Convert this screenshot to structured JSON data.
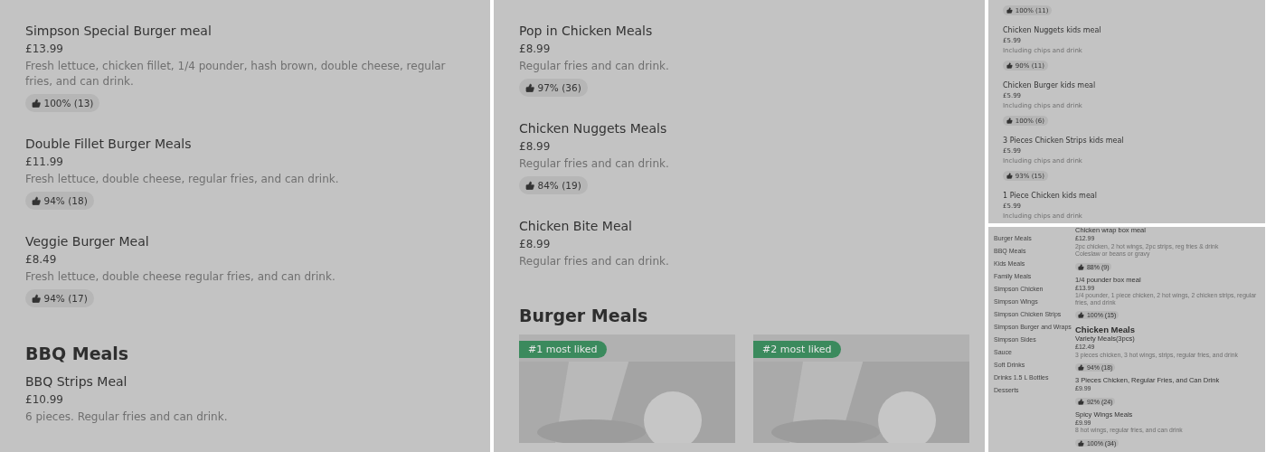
{
  "panels": [
    {
      "kind": "regular",
      "sections": [
        {
          "items": [
            {
              "name": "Simpson Special Burger meal",
              "price": "£13.99",
              "description": "Fresh lettuce, chicken fillet, 1/4 pounder, hash brown, double cheese, regular fries, and can drink.",
              "rating": "100% (13)"
            },
            {
              "name": "Double Fillet Burger Meals",
              "price": "£11.99",
              "description": "Fresh lettuce, double cheese, regular fries, and can drink.",
              "rating": "94% (18)"
            },
            {
              "name": "Veggie Burger Meal",
              "price": "£8.49",
              "description": "Fresh lettuce, double cheese regular fries, and can drink.",
              "rating": "94% (17)"
            }
          ]
        },
        {
          "heading": "BBQ Meals",
          "items": [
            {
              "name": "BBQ Strips Meal",
              "price": "£10.99",
              "description": "6 pieces. Regular fries and can drink."
            }
          ]
        }
      ]
    },
    {
      "kind": "regular",
      "sections": [
        {
          "items": [
            {
              "name": "Pop in Chicken Meals",
              "price": "£8.99",
              "description": "Regular fries and can drink.",
              "rating": "97% (36)"
            },
            {
              "name": "Chicken Nuggets Meals",
              "price": "£8.99",
              "description": "Regular fries and can drink.",
              "rating": "84% (19)"
            },
            {
              "name": "Chicken Bite Meal",
              "price": "£8.99",
              "description": "Regular fries and can drink."
            }
          ]
        },
        {
          "heading": "Burger Meals",
          "cards": [
            {
              "badge": "#1 most liked",
              "kind": "picture"
            },
            {
              "badge": "#2 most liked",
              "kind": "picture"
            }
          ]
        }
      ]
    },
    {
      "kind": "compact",
      "sections": [
        {
          "items": [
            {
              "rating": "100% (11)"
            },
            {
              "name": "Chicken Nuggets kids meal",
              "price": "£5.99",
              "description": "Including chips and drink",
              "rating": "90% (11)"
            },
            {
              "name": "Chicken Burger kids meal",
              "price": "£5.99",
              "description": "Including chips and drink",
              "rating": "100% (6)"
            },
            {
              "name": "3 Pieces Chicken Strips kids meal",
              "price": "£5.99",
              "description": "Including chips and drink",
              "rating": "93% (15)"
            },
            {
              "name": "1 Piece Chicken kids meal",
              "price": "£5.99",
              "description": "Including chips and drink"
            }
          ]
        }
      ]
    },
    {
      "kind": "tiny",
      "sidebar": [
        "Burger Meals",
        "BBQ Meals",
        "Kids Meals",
        "Family Meals",
        "Simpson Chicken",
        "Simpson Wings",
        "Simpson Chicken Strips",
        "Simpson Burger and Wraps",
        "Simpson Sides",
        "Sauce",
        "Soft Drinks",
        "Drinks 1.5 L Bottles",
        "Desserts"
      ],
      "sections": [
        {
          "items": [
            {
              "name": "Chicken wrap box meal",
              "price": "£12.99",
              "description": "2pc chicken, 2 hot wings, 2pc strips, reg fries & drink",
              "note": "Coleslaw or beans or gravy",
              "rating": "88% (9)"
            },
            {
              "name": "1/4 pounder box meal",
              "price": "£13.99",
              "description": "1/4 pounder, 1 piece chicken, 2 hot wings, 2 chicken strips, regular fries, and drink",
              "rating": "100% (15)"
            }
          ]
        },
        {
          "heading": "Chicken Meals",
          "items": [
            {
              "name": "Variety Meals(3pcs)",
              "price": "£12.49",
              "description": "3 pieces chicken, 3 hot wings, strips, regular fries, and drink",
              "rating": "94% (18)"
            },
            {
              "name": "3 Pieces Chicken, Regular Fries, and Can Drink",
              "price": "£9.99",
              "rating": "92% (24)"
            },
            {
              "name": "Spicy Wings Meals",
              "price": "£9.99",
              "description": "8 hot wings, regular fries, and can drink",
              "rating": "100% (34)"
            }
          ]
        }
      ]
    }
  ]
}
